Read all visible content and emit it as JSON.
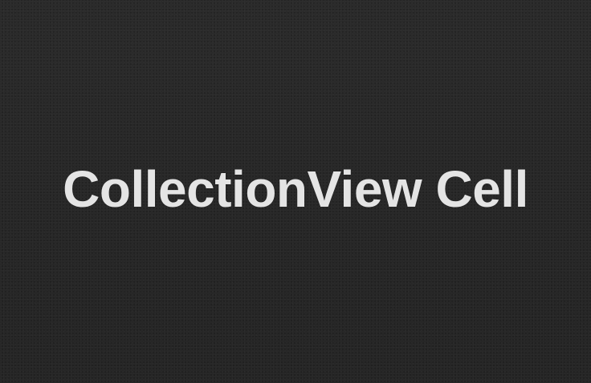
{
  "cell": {
    "title": "CollectionView Cell",
    "background_color": "#282828",
    "text_color": "#e4e4e4"
  }
}
